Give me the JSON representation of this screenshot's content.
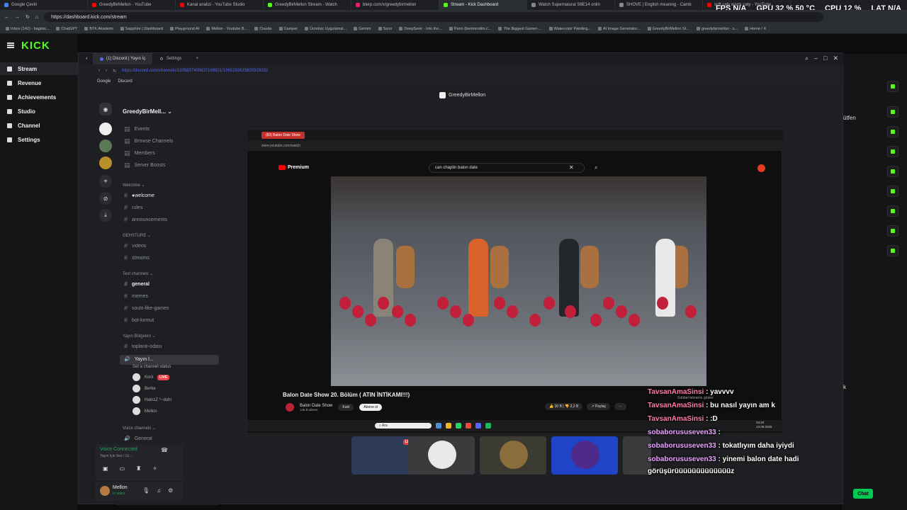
{
  "browser": {
    "tabs": [
      {
        "label": "Google Çeviri",
        "color": "#4285f4"
      },
      {
        "label": "GreedyBirMellon - YouTube",
        "color": "#ff0000"
      },
      {
        "label": "Kanal analizi - YouTube Studio",
        "color": "#ff0000"
      },
      {
        "label": "GreedyBirMellon Stream - Watch",
        "color": "#53fc18"
      },
      {
        "label": "blerp.com/x/greedybirmellon",
        "color": "#e91e63"
      },
      {
        "label": "Stream - Kick Dashboard",
        "color": "#53fc18"
      },
      {
        "label": "Watch Supernatural S6E14 onlin",
        "color": "#888888"
      },
      {
        "label": "SHOVE | English meaning - Camb",
        "color": "#888888"
      },
      {
        "label": "soft caty warm caty - YouTube",
        "color": "#ff0000"
      }
    ],
    "url": "https://dashboard.kick.com/stream",
    "bookmarks": [
      "Inbox (142) - bagisis...",
      "ChatGPT",
      "BTK Akademi",
      "Sapphire | Dashboard",
      "Playground AI",
      "Mellon - Youtube B...",
      "Claude",
      "Camper",
      "Ücretsiz Uygulamal...",
      "Gemini",
      "Suno",
      "DeepSeek - Into the...",
      "Pano (bentrendim.c...",
      "The Biggest Gamer-...",
      "Watercolor Painting...",
      "AI Image Generator...",
      "GreedyBirMellon St...",
      "greedybirmellon - s...",
      "Home / X"
    ]
  },
  "perf": {
    "fps_label": "FPS",
    "fps": "N/A",
    "gpu_label": "GPU",
    "gpu": "32 % 50 °C",
    "cpu_label": "CPU",
    "cpu": "12 %",
    "lat_label": "LAT",
    "lat": "N/A"
  },
  "kick": {
    "logo": "KICK",
    "nav": [
      {
        "label": "Stream"
      },
      {
        "label": "Revenue"
      },
      {
        "label": "Achievements"
      },
      {
        "label": "Studio"
      },
      {
        "label": "Channel"
      },
      {
        "label": "Settings"
      }
    ],
    "right_text_1": "ütfen",
    "right_text_2": "k",
    "chat_button": "Chat"
  },
  "discord": {
    "tab1": "(1) Discord | Yayın İç",
    "tab2": "Settings",
    "url": "https://discord.com/channels/1205837400837169921/1365292615800328232",
    "bookmarks": [
      "Google",
      "Discord"
    ],
    "server_name": "GreedyBirMell...",
    "top_items": [
      "Events",
      "Browse Channels",
      "Members",
      "Server Boosts"
    ],
    "cat_welcome": "Welcome",
    "welcome_channels": [
      "●welcome",
      "rules",
      "announcements"
    ],
    "cat_gehsture": "GEHSTURE",
    "gehsture_channels": [
      "videos",
      "streams"
    ],
    "cat_text": "Text channels",
    "text_channels": [
      "general",
      "memes",
      "souls-like-games",
      "bot-komut"
    ],
    "cat_yayin": "Yayın Bölgeleri",
    "yayin_channels": [
      "toplantı-odası"
    ],
    "voice_selected": "Yayın İ...",
    "voice_status": "Set a channel status",
    "voice_users": [
      {
        "name": "Korii",
        "live": "LIVE"
      },
      {
        "name": "Berke",
        "live": ""
      },
      {
        "name": "HainzZ *~duhi",
        "live": ""
      },
      {
        "name": "Mellon",
        "live": ""
      }
    ],
    "cat_voice": "Voice channels",
    "voice_channels": [
      "General"
    ],
    "vc_title": "Voice Connected",
    "vc_sub": "Yayın İçin Ses / Gr...",
    "user_name": "Mellon",
    "user_status": "In voice",
    "stage_title": "GreedyBirMellon"
  },
  "youtube": {
    "tab": "(83) Balon Date Show",
    "url": "www.youtube.com/watch",
    "brand": "Premium",
    "search": "can chaplin balon date",
    "video_title": "Balon Date Show 20. Bölüm ( ATIN İNTİKAMI!!!)",
    "channel": "Balon Date Show",
    "subs": "146 B abone",
    "join": "Katıl",
    "subscribe": "Abone ol",
    "likes": "30 B",
    "dislikes": "2,2 B",
    "share": "Paylaş",
    "search_task": "Ara",
    "clock_time": "03:20",
    "clock_date": "13.09.2025"
  },
  "chat": {
    "sub_hint": "Sohbet tekrarını göster",
    "messages": [
      {
        "name": "TavsanAmaSinsi",
        "text": " : yavvvv"
      },
      {
        "name": "TavsanAmaSinsi",
        "text": " : bu nasıl yayın am k"
      },
      {
        "name": "TavsanAmaSinsi",
        "text": " : :D"
      },
      {
        "name": "sobaborususeven33",
        "text": " : "
      },
      {
        "name": "sobaborususeven33",
        "text": " : tokatlıyım daha iyiydi"
      },
      {
        "name": "sobaborususeven33",
        "text": " : yinemi balon date hadi"
      },
      {
        "name": "",
        "text": "görüşürüüüüüüüüüüüüüz"
      }
    ]
  },
  "colors": {
    "kick_green": "#53fc18",
    "discord_blurple": "#5865f2",
    "live_red": "#ed4245"
  }
}
